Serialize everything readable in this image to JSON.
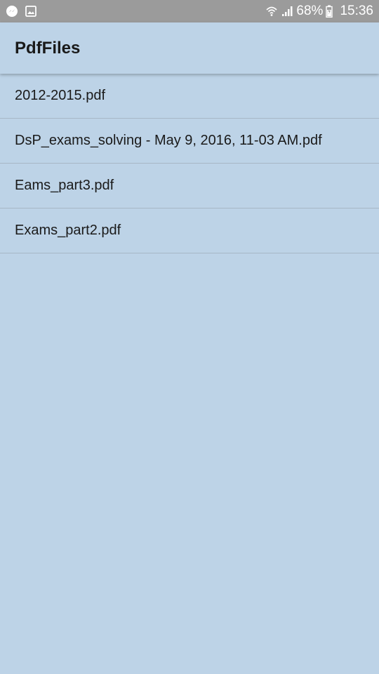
{
  "status_bar": {
    "battery": "68%",
    "time": "15:36",
    "icons": [
      "messenger-icon",
      "gallery-icon",
      "wifi-icon",
      "signal-icon",
      "battery-icon"
    ]
  },
  "app_bar": {
    "title": "PdfFiles"
  },
  "files": [
    "2012-2015.pdf",
    "DsP_exams_solving - May 9, 2016, 11-03 AM.pdf",
    "Eams_part3.pdf",
    "Exams_part2.pdf"
  ],
  "colors": {
    "background": "#bdd3e7",
    "status_bar": "#9b9b9b",
    "divider": "#a7b7c6",
    "text": "#1a1a1a"
  }
}
